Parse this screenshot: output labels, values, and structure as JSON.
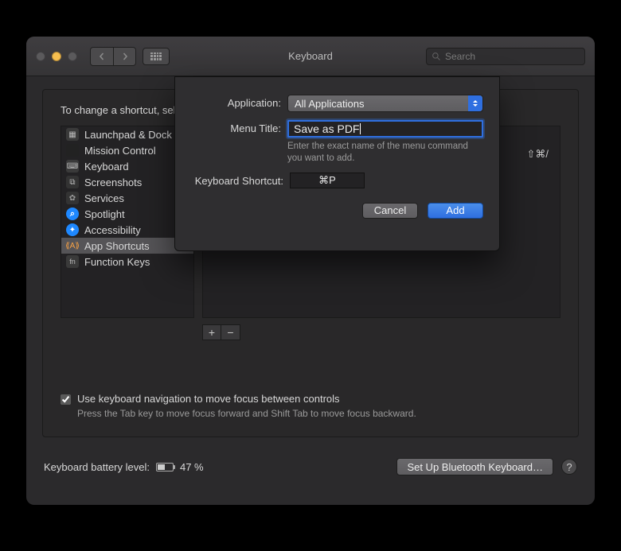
{
  "window": {
    "title": "Keyboard",
    "search_placeholder": "Search"
  },
  "panel": {
    "instruction": "To change a shortcut, select it, double-click the key combination, and then type the new keys.",
    "sidebar": [
      {
        "icon": "launchpad",
        "label": "Launchpad & Dock"
      },
      {
        "icon": "mission",
        "label": "Mission Control"
      },
      {
        "icon": "keyboard",
        "label": "Keyboard"
      },
      {
        "icon": "screenshot",
        "label": "Screenshots"
      },
      {
        "icon": "services",
        "label": "Services"
      },
      {
        "icon": "spotlight",
        "label": "Spotlight"
      },
      {
        "icon": "acc",
        "label": "Accessibility"
      },
      {
        "icon": "app",
        "label": "App Shortcuts",
        "selected": true
      },
      {
        "icon": "fn",
        "label": "Function Keys"
      }
    ],
    "detail_shortcut": "⇧⌘/",
    "checkbox": {
      "checked": true,
      "label": "Use keyboard navigation to move focus between controls",
      "sub": "Press the Tab key to move focus forward and Shift Tab to move focus backward."
    }
  },
  "footer": {
    "battery_label": "Keyboard battery level:",
    "battery_pct": "47 %",
    "bluetooth_btn": "Set Up Bluetooth Keyboard…"
  },
  "sheet": {
    "application_label": "Application:",
    "application_value": "All Applications",
    "menu_title_label": "Menu Title:",
    "menu_title_value": "Save as PDF",
    "menu_title_hint": "Enter the exact name of the menu command you want to add.",
    "shortcut_label": "Keyboard Shortcut:",
    "shortcut_value": "⌘P",
    "cancel": "Cancel",
    "add": "Add"
  }
}
